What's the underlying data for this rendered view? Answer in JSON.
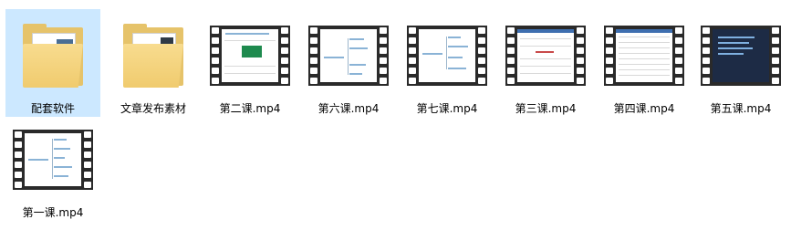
{
  "items": [
    {
      "label": "配套软件",
      "type": "folder",
      "selected": true
    },
    {
      "label": "文章发布素材",
      "type": "folder",
      "selected": false
    },
    {
      "label": "第二课.mp4",
      "type": "video",
      "selected": false
    },
    {
      "label": "第六课.mp4",
      "type": "video",
      "selected": false
    },
    {
      "label": "第七课.mp4",
      "type": "video",
      "selected": false
    },
    {
      "label": "第三课.mp4",
      "type": "video",
      "selected": false
    },
    {
      "label": "第四课.mp4",
      "type": "video",
      "selected": false
    },
    {
      "label": "第五课.mp4",
      "type": "video",
      "selected": false
    },
    {
      "label": "第一课.mp4",
      "type": "video",
      "selected": false
    }
  ],
  "colors": {
    "selection": "#cce8ff",
    "folder": "#f0cb6e",
    "film": "#2a2a2a"
  }
}
